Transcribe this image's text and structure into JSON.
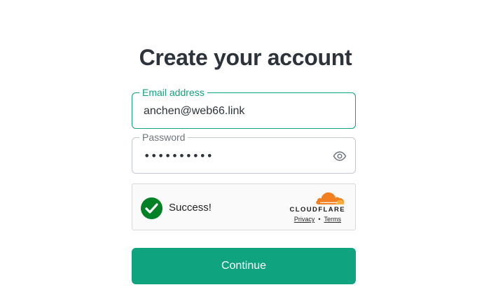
{
  "header": {
    "title": "Create your account"
  },
  "form": {
    "email": {
      "label": "Email address",
      "value": "anchen@web66.link"
    },
    "password": {
      "label": "Password",
      "masked_value": "••••••••••",
      "toggle_icon": "eye-icon"
    },
    "captcha": {
      "status_text": "Success!",
      "provider": "CLOUDFLARE",
      "privacy_link": "Privacy",
      "separator": "•",
      "terms_link": "Terms",
      "check_icon": "checkmark-icon",
      "check_color": "#038127",
      "logo_color": "#f38020"
    },
    "continue_label": "Continue"
  },
  "colors": {
    "accent": "#10a37f",
    "text": "#2d333a",
    "muted": "#6f7780",
    "border": "#c2c8d0"
  }
}
